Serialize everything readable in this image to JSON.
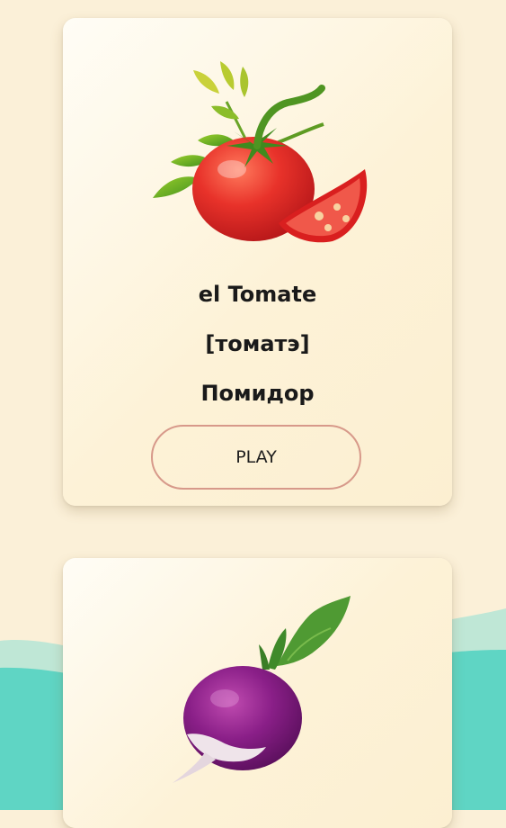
{
  "theme": {
    "background": "#fbf0d8",
    "wave_color": "#5fd5c4",
    "wave_light": "#bfe7d6",
    "play_border": "#d7998a"
  },
  "cards": [
    {
      "image": "tomato-illustration",
      "word": "el Tomate",
      "transcription": "[томатэ]",
      "translation": "Помидор",
      "play_label": "PLAY"
    },
    {
      "image": "radish-illustration"
    }
  ]
}
